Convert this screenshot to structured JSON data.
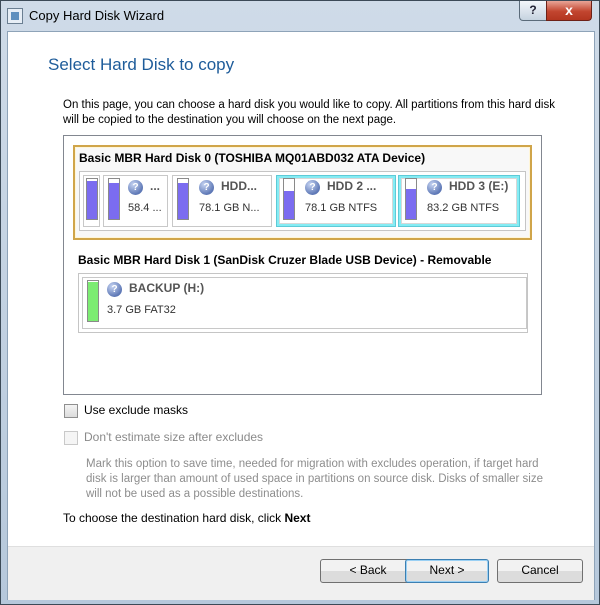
{
  "window": {
    "title": "Copy Hard Disk Wizard",
    "help_glyph": "?",
    "close_glyph": "x"
  },
  "page": {
    "heading": "Select Hard Disk to copy",
    "description": "On this page, you can choose a hard disk you would like to copy. All partitions from this hard disk will be copied to the destination you will choose on the next page."
  },
  "disks": [
    {
      "title": "Basic MBR Hard Disk 0 (TOSHIBA MQ01ABD032 ATA Device)",
      "selected": true,
      "partitions": [
        {
          "name": "",
          "info": "",
          "used": 0.95
        },
        {
          "name": "...",
          "info": "58.4 ...",
          "used": 0.9
        },
        {
          "name": "HDD...",
          "info": "78.1 GB N...",
          "used": 0.9
        },
        {
          "name": "HDD 2 ...",
          "info": "78.1 GB NTFS",
          "used": 0.7,
          "selected": true
        },
        {
          "name": "HDD 3 (E:)",
          "info": "83.2 GB NTFS",
          "used": 0.75,
          "selected": true
        }
      ]
    },
    {
      "title": "Basic MBR Hard Disk 1 (SanDisk Cruzer Blade USB Device) - Removable",
      "selected": false,
      "partitions": [
        {
          "name": "BACKUP (H:)",
          "info": "3.7 GB FAT32",
          "used": 0.98
        }
      ]
    }
  ],
  "options": {
    "exclude_masks": {
      "label": "Use exclude masks",
      "checked": false,
      "enabled": true
    },
    "dont_estimate": {
      "label": "Don't estimate size after excludes",
      "checked": false,
      "enabled": false
    }
  },
  "help_text": "Mark this option to save time, needed for migration with excludes operation, if target hard disk is larger than amount of used space in partitions on source disk. Disks of smaller size will not be used as a possible destinations.",
  "next_hint": {
    "prefix": "To choose the destination hard disk, click",
    "bold": "Next"
  },
  "buttons": {
    "back": "< Back",
    "next": "Next >",
    "cancel": "Cancel"
  },
  "colors": {
    "heading": "#1e5c9a",
    "selection_border": "#d0a54a",
    "partition_selected": "#85ecf4",
    "used_space_ntfs": "#7b6cf0",
    "used_space_fat32": "#7cec72"
  },
  "icons": {
    "partition_icon": "question-icon"
  }
}
